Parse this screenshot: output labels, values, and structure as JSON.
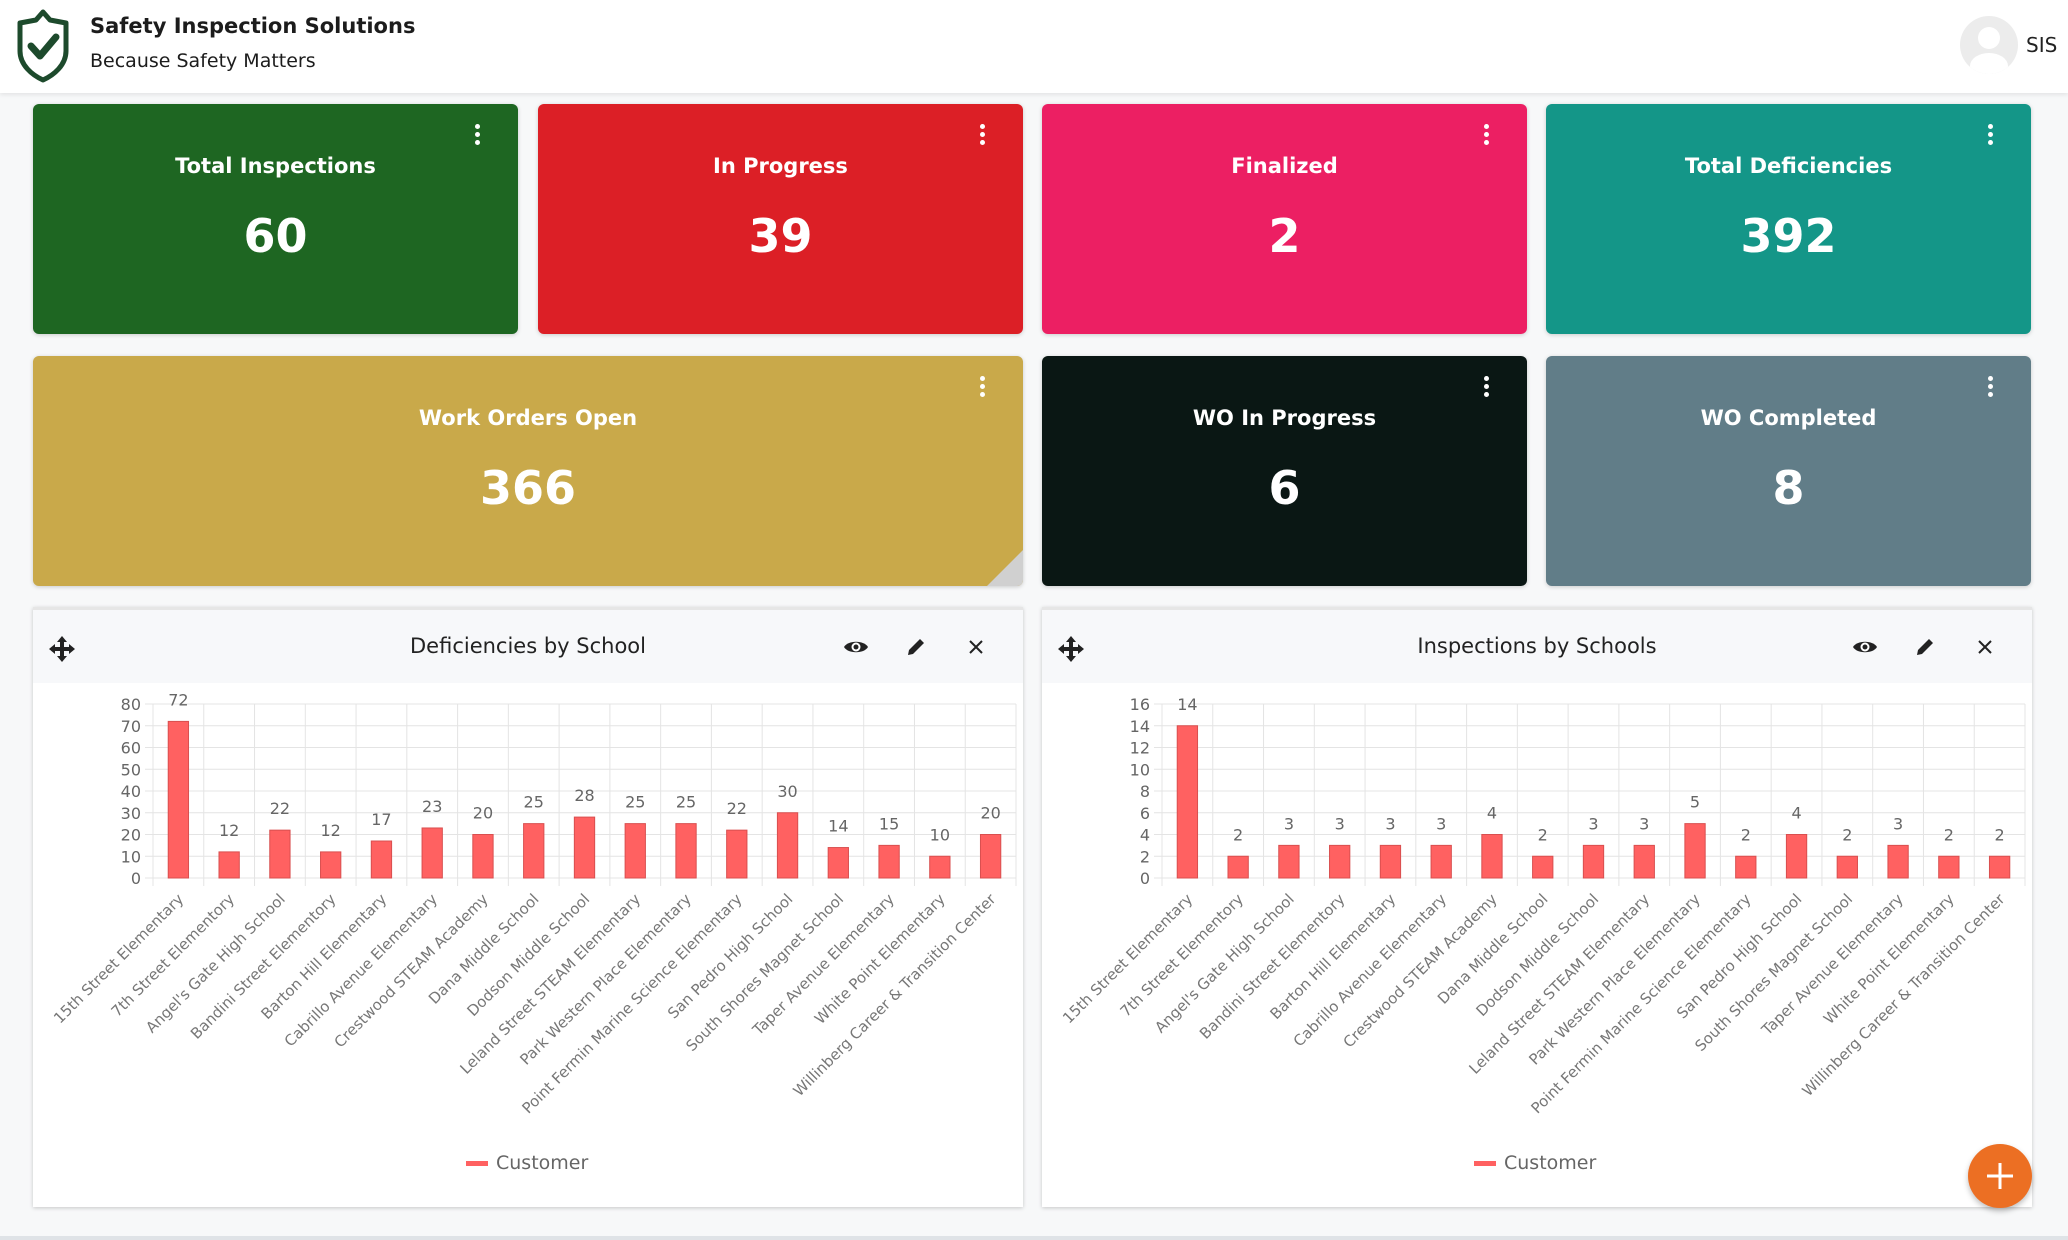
{
  "header": {
    "title": "Safety Inspection Solutions",
    "subtitle": "Because Safety Matters",
    "user_label": "SIS",
    "logo_icon": "shield-check-icon",
    "logo_color": "#1d4a2c"
  },
  "stat_cards": [
    {
      "label": "Total Inspections",
      "value": "60",
      "color": "#1e6622"
    },
    {
      "label": "In Progress",
      "value": "39",
      "color": "#dc1f26"
    },
    {
      "label": "Finalized",
      "value": "2",
      "color": "#ec1f63"
    },
    {
      "label": "Total Deficiencies",
      "value": "392",
      "color": "#149688"
    },
    {
      "label": "Work Orders Open",
      "value": "366",
      "color": "#c9a94a"
    },
    {
      "label": "WO In Progress",
      "value": "6",
      "color": "#0a1714"
    },
    {
      "label": "WO Completed",
      "value": "8",
      "color": "#617d88"
    }
  ],
  "charts": [
    {
      "title": "Deficiencies by School",
      "legend": "Customer"
    },
    {
      "title": "Inspections by Schools",
      "legend": "Customer"
    }
  ],
  "chart_data": [
    {
      "type": "bar",
      "title": "Deficiencies by School",
      "xlabel": "",
      "ylabel": "",
      "ylim": [
        0,
        80
      ],
      "yticks": [
        0,
        10,
        20,
        30,
        40,
        50,
        60,
        70,
        80
      ],
      "grid": true,
      "legend_position": "bottom",
      "bar_color": "#ff6161",
      "categories": [
        "15th Street Elementary",
        "7th Street Elementory",
        "Angel's Gate High School",
        "Bandini Street Elementory",
        "Barton Hill Elementary",
        "Cabrillo Avenue Elementary",
        "Crestwood STEAM Academy",
        "Dana Middle School",
        "Dodson Middle School",
        "Leland Street STEAM Elementary",
        "Park Western Place Elementary",
        "Point Fermin Marine Science Elementary",
        "San Pedro High School",
        "South Shores Magnet School",
        "Taper Avenue Elementary",
        "White Point Elementary",
        "Willinberg Career & Transition Center"
      ],
      "series": [
        {
          "name": "Customer",
          "values": [
            72,
            12,
            22,
            12,
            17,
            23,
            20,
            25,
            28,
            25,
            25,
            22,
            30,
            14,
            15,
            10,
            20
          ]
        }
      ]
    },
    {
      "type": "bar",
      "title": "Inspections by Schools",
      "xlabel": "",
      "ylabel": "",
      "ylim": [
        0,
        16
      ],
      "yticks": [
        0,
        2,
        4,
        6,
        8,
        10,
        12,
        14,
        16
      ],
      "grid": true,
      "legend_position": "bottom",
      "bar_color": "#ff6161",
      "categories": [
        "15th Street Elementary",
        "7th Street Elementory",
        "Angel's Gate High School",
        "Bandini Street Elementory",
        "Barton Hill Elementary",
        "Cabrillo Avenue Elementary",
        "Crestwood STEAM Academy",
        "Dana Middle School",
        "Dodson Middle School",
        "Leland Street STEAM Elementary",
        "Park Western Place Elementary",
        "Point Fermin Marine Science Elementary",
        "San Pedro High School",
        "South Shores Magnet School",
        "Taper Avenue Elementary",
        "White Point Elementary",
        "Willinberg Career & Transition Center"
      ],
      "series": [
        {
          "name": "Customer",
          "values": [
            14,
            2,
            3,
            3,
            3,
            3,
            4,
            2,
            3,
            3,
            5,
            2,
            4,
            2,
            3,
            2,
            2
          ]
        }
      ]
    }
  ],
  "fab": {
    "icon": "plus-icon",
    "color": "#ec6f23"
  }
}
